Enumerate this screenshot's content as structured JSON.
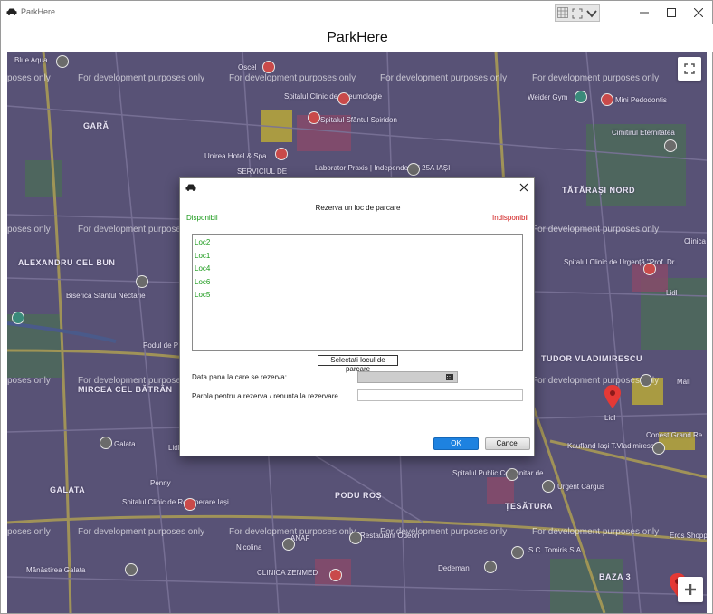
{
  "window": {
    "title": "ParkHere",
    "header_title": "ParkHere"
  },
  "map": {
    "watermark": "For development purposes only",
    "watermark_partial": "poses only",
    "labels": {
      "blue_aqua": "Blue Aqua",
      "oscel": "Oscel",
      "spital_pneumologie": "Spitalul Clinic de Pneumologie",
      "spital_spiridon": "Spitalul Sfântul Spiridon",
      "gara": "GARĂ",
      "unirea_hotel": "Unirea Hotel & Spa",
      "serviciul": "SERVICIUL DE",
      "laborator": "Laborator Praxis | Independenței 25A IAȘI",
      "weider_gym": "Weider Gym",
      "mini_pedodontis": "Mini Pedodontis",
      "cimitirul": "Cimitirul Eternitatea",
      "tatarasi_nord": "TĂTĂRAȘI NORD",
      "alexandru_cel_bun": "ALEXANDRU CEL BUN",
      "biserica_nectarie": "Biserica Sfântul Nectarie",
      "podul_de_piatra": "Podul de P",
      "spital_urgenta": "Spitalul Clinic de Urgență \"Prof. Dr.",
      "lidi1": "Lidl",
      "tudor_vladimirescu": "TUDOR VLADIMIRESCU",
      "mircea_cel_batran": "MIRCEA CEL BĂTRÂN",
      "iulius_mall": "Mall",
      "clinica_ofta": "Clinica Ofta",
      "ipo_galata": "Galata",
      "lidi2": "Lidl",
      "kaufland": "Kaufland Iași T.Vladimirescu",
      "conest": "Conest Grand Re",
      "penny": "Penny",
      "galata": "GALATA",
      "spital_recuperare": "Spitalul Clinic de Recuperare Iași",
      "spital_public": "Spitalul Public Comunitar de",
      "podu_ros": "PODU ROȘ",
      "urgent_cargus": "Urgent Cargus",
      "tesatura": "ȚESĂTURA",
      "nicolina": "Nicolina",
      "anaf": "ANAF",
      "restaurant_odeon": "Restaurant Odeon",
      "stomiris": "S.C. Tomiris S.A.",
      "eros_shopping": "Eros Shopping",
      "manastirea_galata": "Mănăstirea Galata",
      "clinica_zenmed": "CLINICA ZENMED",
      "dedeman": "Dedeman",
      "baza3": "BAZA 3",
      "lidl3": "Lidl"
    }
  },
  "dialog": {
    "title": "Rezerva un loc de parcare",
    "available_label": "Disponibil",
    "unavailable_label": "Indisponibil",
    "spots": [
      "Loc2",
      "Loc1",
      "Loc4",
      "Loc6",
      "Loc5"
    ],
    "select_button": "Selectati locul de parcare",
    "date_label": "Data pana la care se rezerva:",
    "password_label": "Parola pentru a rezerva / renunta la rezervare",
    "ok_button": "OK",
    "cancel_button": "Cancel"
  },
  "colors": {
    "available": "#1a9a1a",
    "unavailable": "#d01818",
    "accent": "#1e82e0",
    "map_overlay": "#5a5478"
  }
}
